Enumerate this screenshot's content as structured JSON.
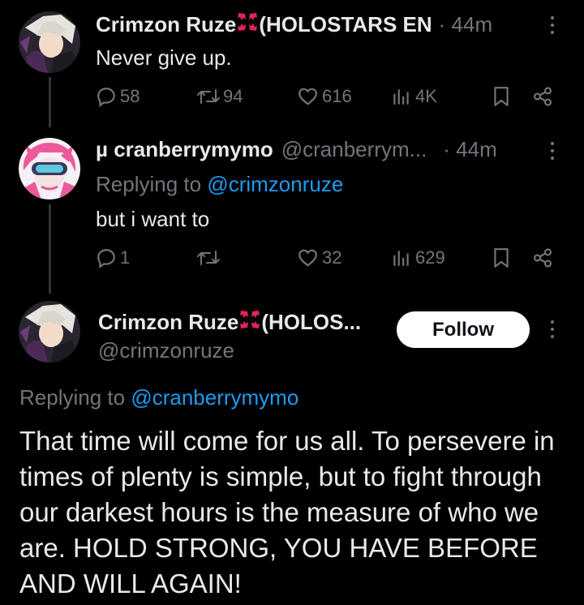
{
  "tweets": [
    {
      "author_name": "Crimzon Ruze",
      "author_suffix": "(HOLOSTARS EN",
      "time": "· 44m",
      "text": "Never give up.",
      "replies": "58",
      "retweets": "94",
      "likes": "616",
      "views": "4K"
    },
    {
      "author_name": "µ cranberrymymo",
      "handle": "@cranberrym...",
      "time": "· 44m",
      "replying_prefix": "Replying to",
      "replying_handle": "@crimzonruze",
      "text": "but i want to",
      "replies": "1",
      "retweets": "",
      "likes": "32",
      "views": "629"
    }
  ],
  "main_tweet": {
    "author_name": "Crimzon Ruze",
    "author_suffix": "(HOLOS...",
    "handle": "@crimzonruze",
    "follow_label": "Follow",
    "replying_prefix": "Replying to",
    "replying_handle": "@cranberrymymo",
    "text": "That time will come for us all.  To persevere in times of plenty is simple, but to fight through our darkest hours is the measure of who we are.  HOLD STRONG, YOU HAVE BEFORE AND WILL AGAIN!"
  },
  "icons": {
    "reply": "reply-icon",
    "retweet": "retweet-icon",
    "like": "heart-icon",
    "views": "views-icon",
    "bookmark": "bookmark-icon",
    "share": "share-icon",
    "emoji": "anger-symbol-emoji",
    "more": "more-options-icon"
  },
  "colors": {
    "background": "#000000",
    "text": "#e7e9ea",
    "secondary": "#71767b",
    "link": "#1d9bf0",
    "emoji": "#e0245e"
  }
}
